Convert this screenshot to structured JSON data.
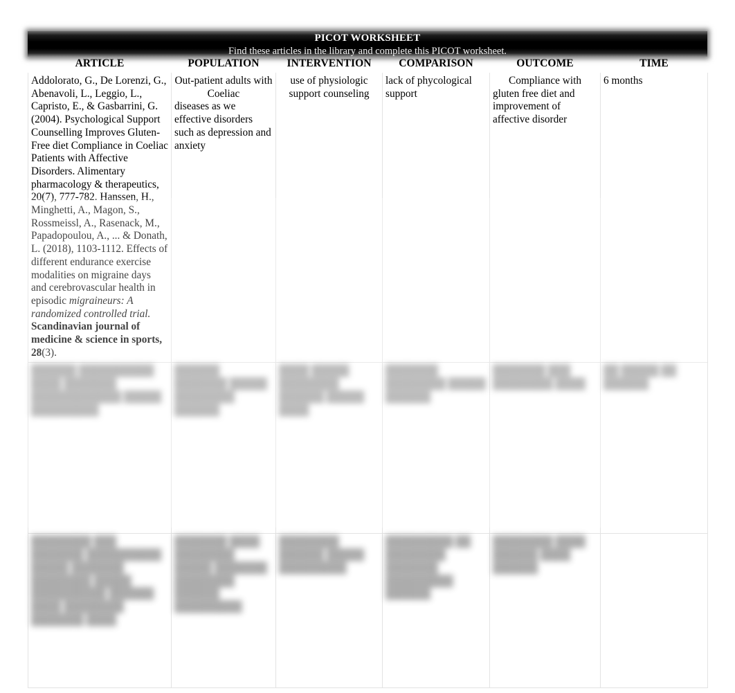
{
  "title": {
    "main": "PICOT WORKSHEET",
    "subtitle": "Find these articles in the library and complete this PICOT worksheet."
  },
  "colors": {
    "header_band": "#000000",
    "header_text": "#ffffff",
    "page_background": "#ffffff",
    "grid_line": "#e3e3e3",
    "body_text": "#000000"
  },
  "columns": [
    {
      "key": "article",
      "label": "ARTICLE"
    },
    {
      "key": "population",
      "label": "POPULATION"
    },
    {
      "key": "intervention",
      "label": "INTERVENTION"
    },
    {
      "key": "comparison",
      "label": "COMPARISON"
    },
    {
      "key": "outcome",
      "label": "OUTCOME"
    },
    {
      "key": "time",
      "label": "TIME"
    }
  ],
  "rows": [
    {
      "legible": true,
      "article": {
        "citation_1": "Addolorato, G., De Lorenzi, G., Abenavoli, L., Leggio, L., Capristo, E., & Gasbarrini, G. (2004). Psychological Support Counselling Improves Gluten-Free diet Compliance in Coeliac Patients with Affective Disorders.",
        "journal_1": "Alimentary pharmacology & therapeutics, 20(7), 777-782.",
        "citation_2": "Hanssen, H., Minghetti, A., Magon, S., Rossmeissl, A., Rasenack, M., Papadopoulou, A., ... & Donath, L. (2018), 1103-1112. Effects of different endurance exercise modalities on migraine days and cerebrovascular health in episodic ",
        "citation_2_italic": "migraineurs: A randomized controlled trial.",
        "journal_2_bold": "Scandinavian journal of medicine & science in sports, 28",
        "journal_2_tail": "(3)."
      },
      "population_lead": "Out-patient adults with Coeliac",
      "population_body": "diseases as we effective disorders such as depression and anxiety",
      "intervention": "use of physiologic support counseling",
      "comparison": "lack of phycological support",
      "outcome_lead": " Compliance with",
      "outcome_body": "gluten free diet and improvement of affective disorder",
      "time": "6 months"
    },
    {
      "legible": false,
      "note": "redacted-blurred-row",
      "article": "██████ ██████████ ████ ███████ ████████████ █████ █████████",
      "population": "██████ ███████ █████ ████████ ██████",
      "intervention": "████ █████ ████████ ██████ █████ ████",
      "comparison": "███████ ████████ █████ ██████",
      "outcome": "███████ ███ ████████ ████",
      "time": "██ █████ ██ ██████"
    },
    {
      "legible": false,
      "note": "redacted-blurred-row",
      "article": "████████ ███ ███████ ██████████ █████ ███████ ████████ █████ ██████████ ██████ ████ ████████ ███████ ████",
      "population": "███████ ████ ████████ █████ ███████ ████████ ██████ █████████",
      "intervention": "████████ ██████ █████ █████████",
      "comparison": "█████████ ██ ████████ ███████ █████████ ██████",
      "outcome": "████████ ████ ██████ ████ ██████",
      "time": ""
    }
  ]
}
